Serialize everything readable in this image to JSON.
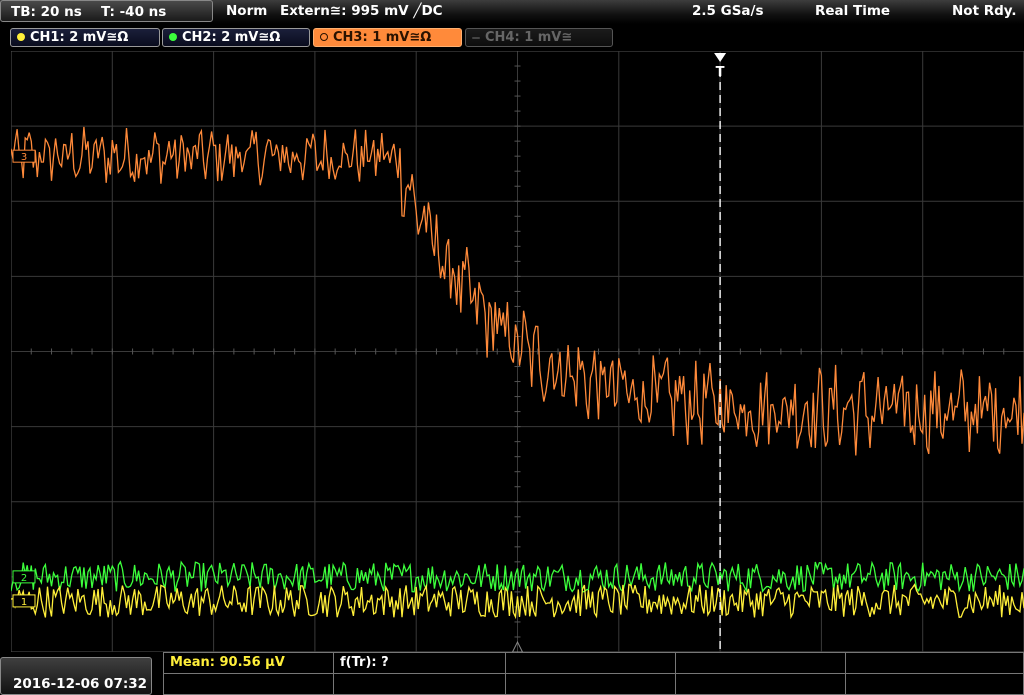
{
  "status_bar": {
    "timebase": "TB: 20 ns",
    "trigger_time": "T: -40 ns",
    "trigger_mode": "Norm",
    "trigger_source": "Extern≅: 995 mV ╱DC",
    "sample_rate": "2.5 GSa/s",
    "acquisition_mode": "Real Time",
    "run_state": "Not Rdy."
  },
  "channels": [
    {
      "id": "CH1",
      "label": "CH1: 2 mV≅Ω",
      "color": "#ffef3a",
      "state": "on"
    },
    {
      "id": "CH2",
      "label": "CH2: 2 mV≅Ω",
      "color": "#3cff3c",
      "state": "on"
    },
    {
      "id": "CH3",
      "label": "CH3: 1 mV≅Ω",
      "color": "#ff8a3a",
      "state": "active"
    },
    {
      "id": "CH4",
      "label": "CH4: 1 mV≅",
      "color": "#5a5a5a",
      "state": "off"
    }
  ],
  "markers": {
    "ch3_ref": "3",
    "ch2_ref": "2",
    "ch1_ref": "1",
    "trigger_label": "T"
  },
  "footer": {
    "datetime": "2016-12-06 07:32",
    "measurements": [
      {
        "label": "Mean: 90.56 µV",
        "color": "#ffef3a"
      },
      {
        "label": "f(Tr): ?",
        "color": "#ffffff"
      }
    ]
  },
  "colors": {
    "grid": "#3a3a3a",
    "ch1": "#ffef3a",
    "ch2": "#3cff3c",
    "ch3": "#ff8a3a",
    "trigger": "#ffffff"
  },
  "chart_data": {
    "type": "line",
    "divisions_x": 10,
    "divisions_y": 8,
    "trigger_x_div": 7.0,
    "series": [
      {
        "name": "CH3",
        "color": "#ff8a3a",
        "level_start_div": 6.6,
        "level_end_div": 3.2,
        "step_x_div": 3.8,
        "noise_div": 0.35
      },
      {
        "name": "CH2",
        "color": "#3cff3c",
        "level_div": 1.0,
        "noise_div": 0.2
      },
      {
        "name": "CH1",
        "color": "#ffef3a",
        "level_div": 0.68,
        "noise_div": 0.22
      }
    ]
  }
}
